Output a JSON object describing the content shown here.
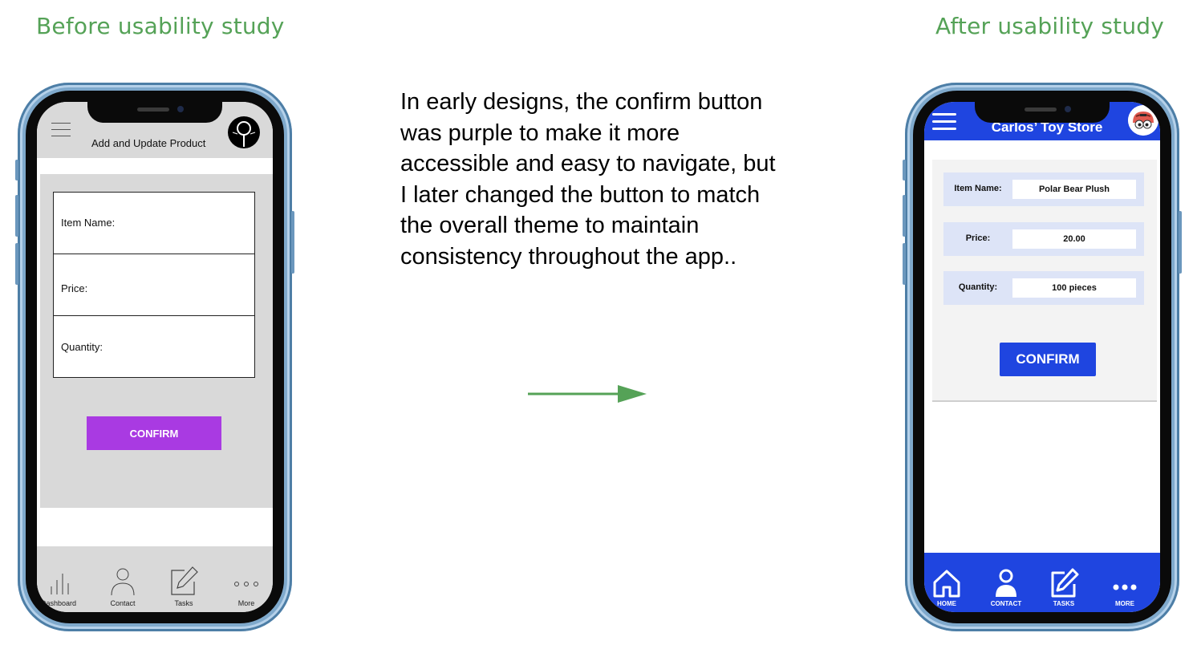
{
  "headings": {
    "before": "Before usability study",
    "after": "After usability study"
  },
  "description": "In early designs, the confirm button was purple to make it more accessible and easy to navigate, but I later changed the button to match the overall theme to maintain consistency throughout the app..",
  "colors": {
    "heading": "#55a257",
    "arrow": "#55a257",
    "before_confirm": "#a93ae2",
    "after_theme": "#1f45e0"
  },
  "before": {
    "title": "Add and Update Product",
    "form": {
      "item_name_label": "Item Name:",
      "price_label": "Price:",
      "quantity_label": "Quantity:"
    },
    "confirm_label": "CONFIRM",
    "nav": [
      {
        "label": "Dashboard",
        "icon": "bar-chart-icon"
      },
      {
        "label": "Contact",
        "icon": "person-icon"
      },
      {
        "label": "Tasks",
        "icon": "edit-icon"
      },
      {
        "label": "More",
        "icon": "more-icon"
      }
    ]
  },
  "after": {
    "title": "Carlos’ Toy Store",
    "form": {
      "item_name_label": "Item Name:",
      "item_name_value": "Polar Bear Plush",
      "price_label": "Price:",
      "price_value": "20.00",
      "quantity_label": "Quantity:",
      "quantity_value": "100 pieces"
    },
    "confirm_label": "CONFIRM",
    "nav": [
      {
        "label": "HOME",
        "icon": "home-icon"
      },
      {
        "label": "CONTACT",
        "icon": "person-icon"
      },
      {
        "label": "TASKS",
        "icon": "edit-icon"
      },
      {
        "label": "MORE",
        "icon": "more-icon"
      }
    ]
  }
}
